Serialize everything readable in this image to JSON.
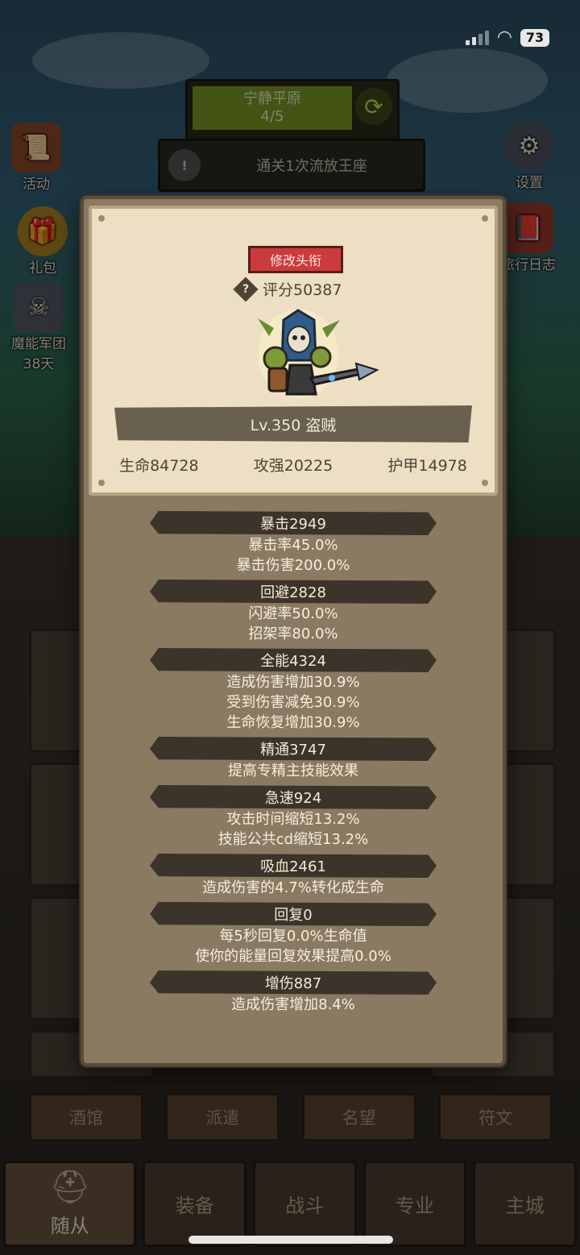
{
  "status_bar": {
    "battery": "73"
  },
  "hud": {
    "map_name": "宁静平原",
    "map_progress": "4/5",
    "quest": "通关1次流放王座",
    "left_buttons": [
      {
        "label": "活动"
      },
      {
        "label": "礼包"
      },
      {
        "label": "魔能军团",
        "sub": "38天"
      }
    ],
    "right_buttons": [
      {
        "label": "设置"
      },
      {
        "label": "旅行日志"
      }
    ]
  },
  "modal": {
    "change_title_button": "修改头衔",
    "score": "评分50387",
    "level_class": "Lv.350 盗贼",
    "main_stats": [
      "生命84728",
      "攻强20225",
      "护甲14978"
    ],
    "attributes": [
      {
        "title": "暴击2949",
        "details": [
          "暴击率45.0%",
          "暴击伤害200.0%"
        ]
      },
      {
        "title": "回避2828",
        "details": [
          "闪避率50.0%",
          "招架率80.0%"
        ]
      },
      {
        "title": "全能4324",
        "details": [
          "造成伤害增加30.9%",
          "受到伤害减免30.9%",
          "生命恢复增加30.9%"
        ]
      },
      {
        "title": "精通3747",
        "details": [
          "提高专精主技能效果"
        ]
      },
      {
        "title": "急速924",
        "details": [
          "攻击时间缩短13.2%",
          "技能公共cd缩短13.2%"
        ]
      },
      {
        "title": "吸血2461",
        "details": [
          "造成伤害的4.7%转化成生命"
        ]
      },
      {
        "title": "回复0",
        "details": [
          "每5秒回复0.0%生命值",
          "使你的能量回复效果提高0.0%"
        ]
      },
      {
        "title": "增伤887",
        "details": [
          "造成伤害增加8.4%"
        ]
      }
    ]
  },
  "sub_tabs": [
    "酒馆",
    "派遣",
    "名望",
    "符文"
  ],
  "bottom_nav": [
    "随从",
    "装备",
    "战斗",
    "专业",
    "主城"
  ],
  "colors": {
    "title_button": "#cc3b3b",
    "parchment": "#ecdfc4",
    "panel": "#8a7a62"
  }
}
